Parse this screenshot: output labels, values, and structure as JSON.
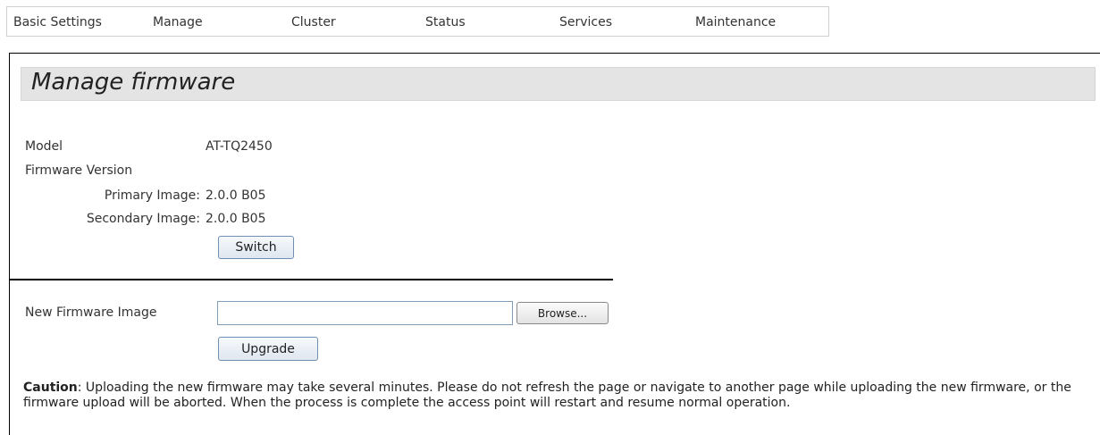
{
  "nav": {
    "items": [
      {
        "label": "Basic Settings"
      },
      {
        "label": "Manage"
      },
      {
        "label": "Cluster"
      },
      {
        "label": "Status"
      },
      {
        "label": "Services"
      },
      {
        "label": "Maintenance"
      }
    ]
  },
  "page": {
    "title": "Manage firmware"
  },
  "info": {
    "model_label": "Model",
    "model_value": "AT-TQ2450",
    "firmware_version_label": "Firmware Version",
    "primary_label": "Primary Image:",
    "primary_value": "2.0.0 B05",
    "secondary_label": "Secondary Image:",
    "secondary_value": "2.0.0 B05",
    "switch_label": "Switch"
  },
  "upload": {
    "new_image_label": "New Firmware Image",
    "file_value": "",
    "browse_label": "Browse...",
    "upgrade_label": "Upgrade"
  },
  "caution": {
    "prefix": "Caution",
    "text": ": Uploading the new firmware may take several minutes. Please do not refresh the page or navigate to another page while uploading the new firmware, or the firmware upload will be aborted. When the process is complete the access point will restart and resume normal operation."
  }
}
